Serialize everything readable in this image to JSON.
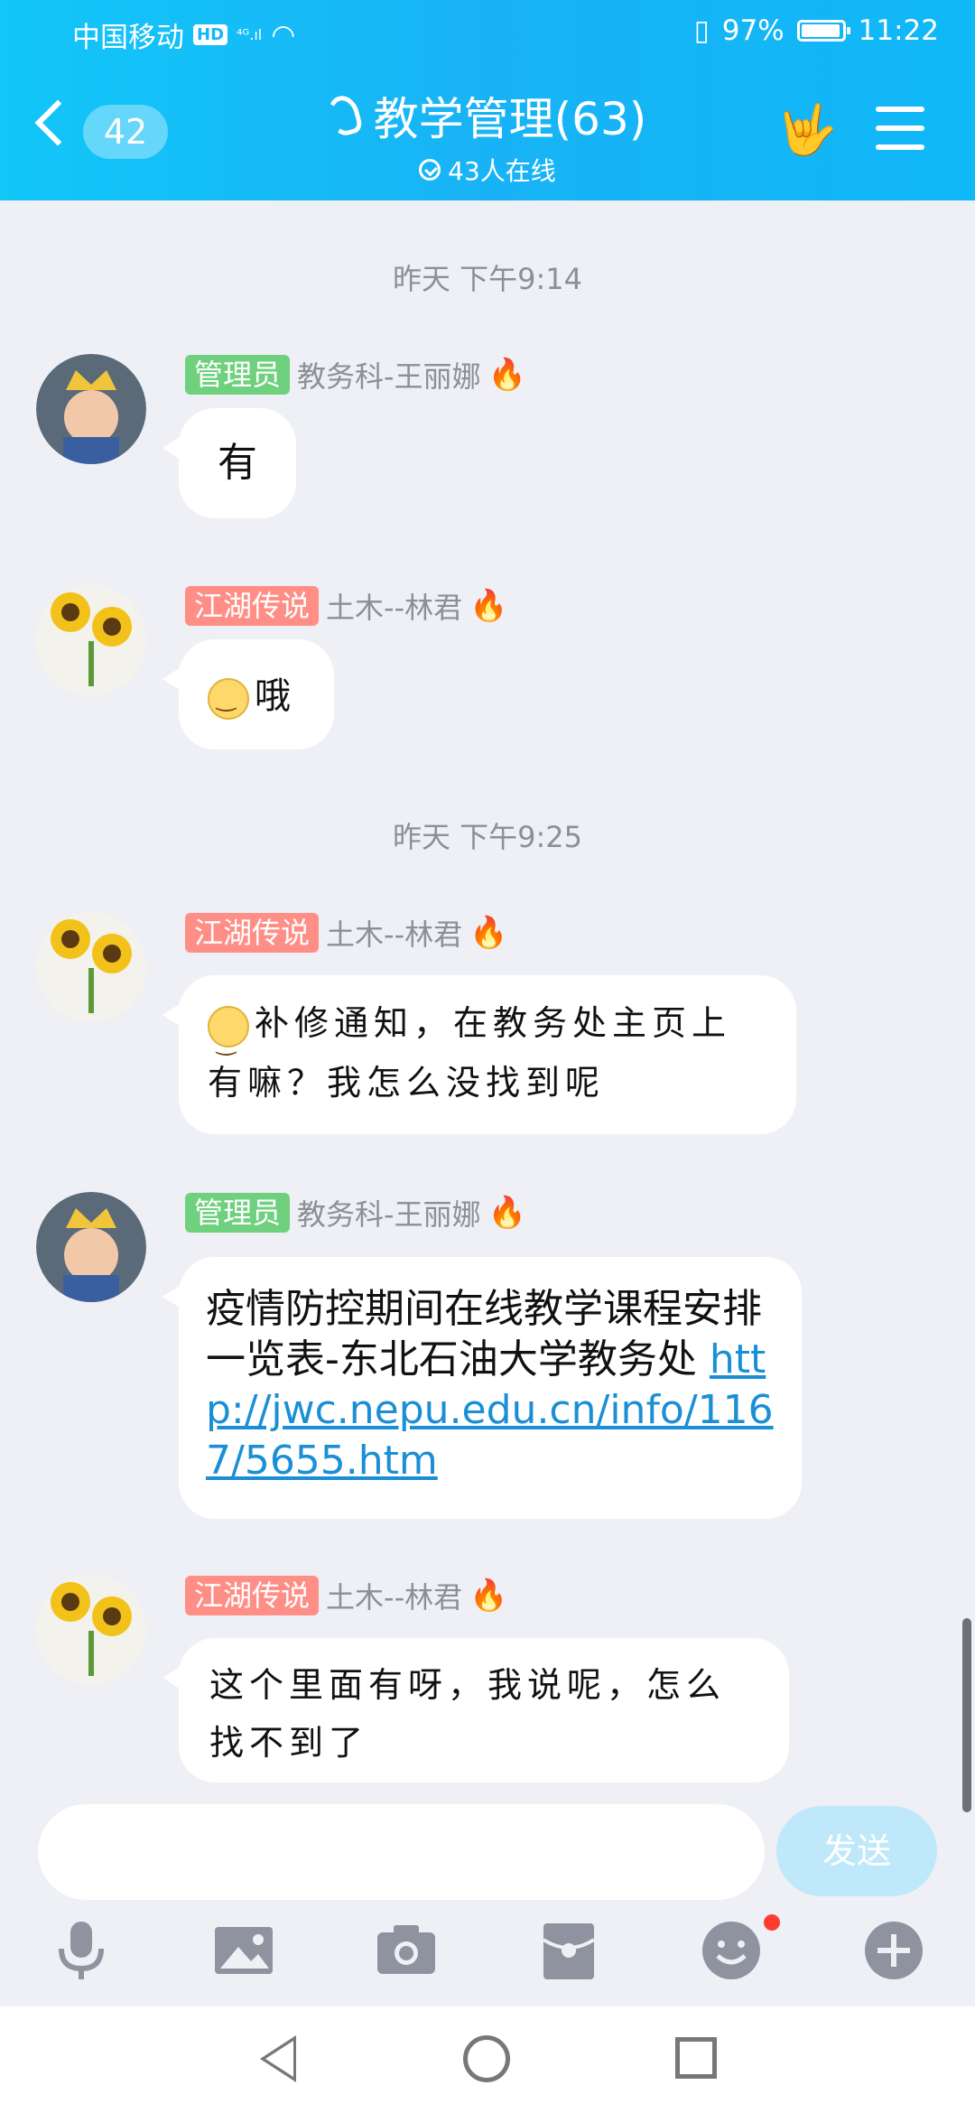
{
  "status_bar": {
    "carrier": "中国移动",
    "hd": "HD",
    "signal": "⁴ᴳ.ıl",
    "battery": "97%",
    "time": "11:22"
  },
  "header": {
    "unread_count": "42",
    "title": "教学管理(63)",
    "online": "43人在线",
    "brand_color": "#16b6f6"
  },
  "timestamps": [
    "昨天 下午9:14",
    "昨天 下午9:25"
  ],
  "messages": [
    {
      "role": "管理员",
      "sender": "教务科-王丽娜",
      "text": "有"
    },
    {
      "role": "江湖传说",
      "sender": "土木--林君",
      "text": "哦"
    },
    {
      "role": "江湖传说",
      "sender": "土木--林君",
      "text": "补修通知，在教务处主页上有嘛？我怎么没找到呢"
    },
    {
      "role": "管理员",
      "sender": "教务科-王丽娜",
      "text": "疫情防控期间在线教学课程安排一览表-东北石油大学教务处 ",
      "link": "http://jwc.nepu.edu.cn/info/1167/5655.htm"
    },
    {
      "role": "江湖传说",
      "sender": "土木--林君",
      "text": "这个里面有呀，我说呢，怎么找不到了"
    }
  ],
  "input": {
    "placeholder": "",
    "send_label": "发送"
  },
  "icons": {
    "flame": "🔥",
    "tools": [
      "microphone-icon",
      "image-icon",
      "camera-icon",
      "red-packet-icon",
      "emoji-icon",
      "plus-icon"
    ]
  }
}
